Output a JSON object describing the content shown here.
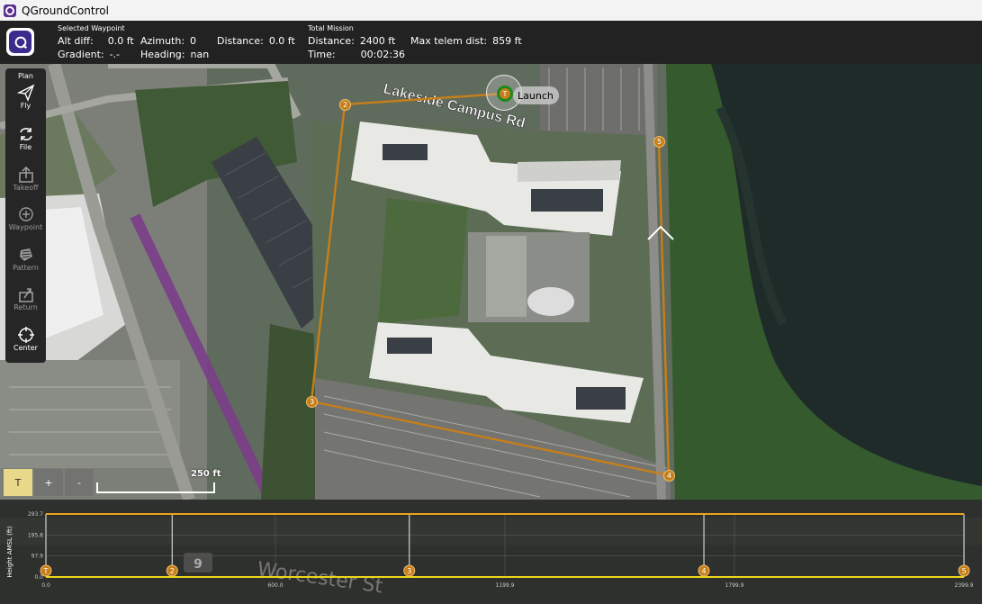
{
  "window": {
    "title": "QGroundControl"
  },
  "toolbar": {
    "selected_heading": "Selected Waypoint",
    "alt_diff_label": "Alt diff:",
    "alt_diff_value": "0.0 ft",
    "azimuth_label": "Azimuth:",
    "azimuth_value": "0",
    "distance_label": "Distance:",
    "distance_value": "0.0 ft",
    "gradient_label": "Gradient:",
    "gradient_value": "-.-",
    "heading_label": "Heading:",
    "heading_value": "nan",
    "total_heading": "Total Mission",
    "total_distance_label": "Distance:",
    "total_distance_value": "2400 ft",
    "time_label": "Time:",
    "time_value": "00:02:36",
    "max_telem_label": "Max telem dist:",
    "max_telem_value": "859 ft"
  },
  "plan_tools": {
    "header": "Plan",
    "items": [
      {
        "label": "Fly",
        "icon": "paper-plane-icon",
        "enabled": true
      },
      {
        "label": "File",
        "icon": "sync-icon",
        "enabled": true
      },
      {
        "label": "Takeoff",
        "icon": "takeoff-icon",
        "enabled": false
      },
      {
        "label": "Waypoint",
        "icon": "plus-circle-icon",
        "enabled": false
      },
      {
        "label": "Pattern",
        "icon": "pattern-icon",
        "enabled": false
      },
      {
        "label": "Return",
        "icon": "return-icon",
        "enabled": false
      },
      {
        "label": "Center",
        "icon": "crosshair-icon",
        "enabled": true
      }
    ]
  },
  "map": {
    "street_label": "Lakeside Campus Rd",
    "scale_label": "250 ft",
    "zoom_buttons": [
      "T",
      "+",
      "-"
    ],
    "launch_label": "Launch",
    "launch_marker": "T",
    "waypoints": [
      "2",
      "3",
      "4",
      "5"
    ]
  },
  "chart_data": {
    "type": "line",
    "ylabel": "Height AMSL (ft)",
    "y_ticks": [
      "293.7",
      "195.8",
      "97.9",
      "0.0"
    ],
    "x_ticks": [
      "0.0",
      "600.0",
      "1199.9",
      "1799.9",
      "2399.9"
    ],
    "ylim": [
      0,
      293.7
    ],
    "xlim": [
      0,
      2399.9
    ],
    "waypoint_markers": [
      {
        "label": "T",
        "x": 0
      },
      {
        "label": "2",
        "x": 330
      },
      {
        "label": "3",
        "x": 950
      },
      {
        "label": "4",
        "x": 1720
      },
      {
        "label": "5",
        "x": 2399.9
      }
    ],
    "series": [
      {
        "x": [
          0,
          2399.9
        ],
        "y": [
          293.7,
          293.7
        ]
      },
      {
        "x": [
          0,
          2399.9
        ],
        "y": [
          0,
          0
        ]
      }
    ],
    "background_text": [
      "9",
      "Worcester St"
    ]
  }
}
